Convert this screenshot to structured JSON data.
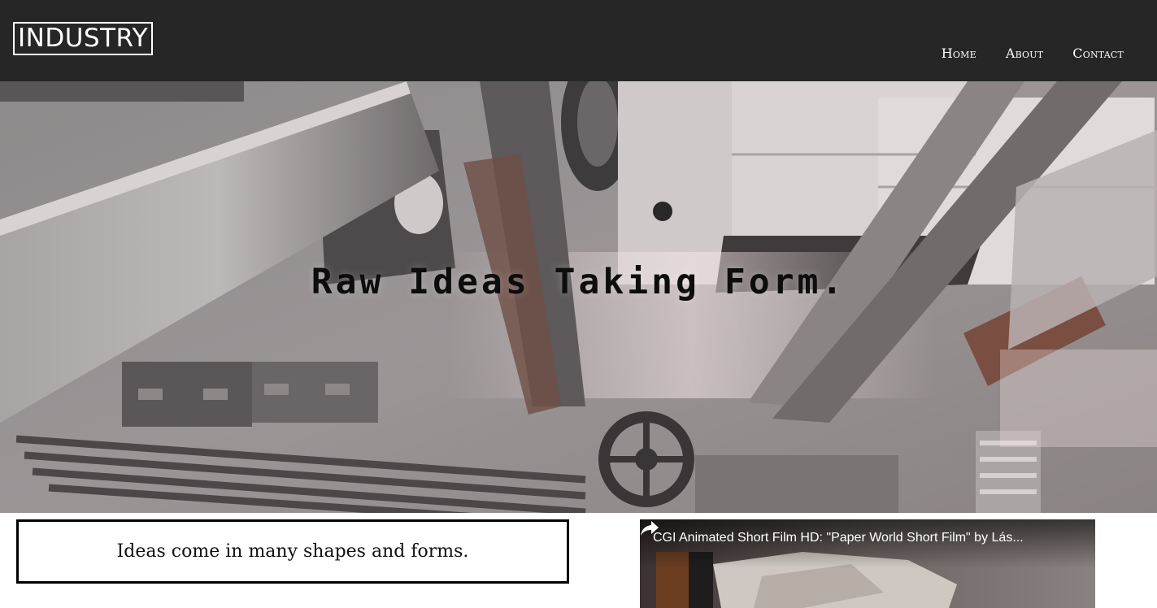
{
  "header": {
    "logo": "INDUSTRY",
    "nav": [
      "Home",
      "About",
      "Contact"
    ]
  },
  "hero": {
    "title": "Raw Ideas Taking Form."
  },
  "content": {
    "box_heading": "Ideas come in many shapes and forms.",
    "body_text": ""
  },
  "video": {
    "title": "CGI Animated Short Film HD: \"Paper World Short Film\" by Lás...",
    "share_icon": "share-icon"
  },
  "colors": {
    "header_bg": "#262626",
    "accent_white": "#ffffff"
  }
}
